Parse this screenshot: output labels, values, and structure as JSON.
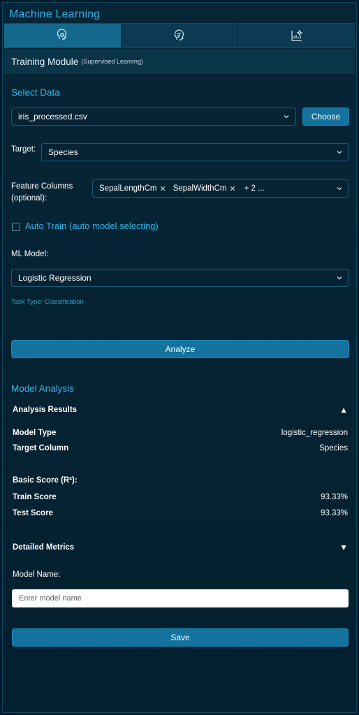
{
  "app": {
    "title": "Machine Learning"
  },
  "tabs": [
    {
      "icon": "brain-gear-icon",
      "active": true
    },
    {
      "icon": "brain-list-icon",
      "active": false
    },
    {
      "icon": "chart-sparkle-icon",
      "active": false
    }
  ],
  "module": {
    "title": "Training Module",
    "subtitle": "(Supervised Learning)"
  },
  "select_data": {
    "heading": "Select Data",
    "file_value": "iris_processed.csv",
    "choose_label": "Choose",
    "target_label": "Target:",
    "target_value": "Species",
    "features_label": "Feature Columns (optional):",
    "feature_chips": [
      "SepalLengthCm",
      "SepalWidthCm"
    ],
    "features_more": "+ 2 ...",
    "auto_train_label": "Auto Train (auto model selecting)",
    "auto_train_checked": false,
    "model_label": "ML Model:",
    "model_value": "Logistic Regression",
    "task_type": "Task Type: Classification",
    "analyze_label": "Analyze"
  },
  "analysis": {
    "heading": "Model Analysis",
    "results_title": "Analysis Results",
    "results_expanded": true,
    "model_type_label": "Model Type",
    "model_type_value": "logistic_regression",
    "target_col_label": "Target Column",
    "target_col_value": "Species",
    "basic_score_label": "Basic Score (R²):",
    "train_score_label": "Train Score",
    "train_score_value": "93.33%",
    "test_score_label": "Test Score",
    "test_score_value": "93.33%",
    "detailed_title": "Detailed Metrics",
    "detailed_expanded": false,
    "model_name_label": "Model Name:",
    "model_name_placeholder": "Enter model name",
    "model_name_value": "",
    "save_label": "Save"
  },
  "colors": {
    "accent": "#2fb4e6",
    "button": "#13739e",
    "background": "#041c2a"
  }
}
